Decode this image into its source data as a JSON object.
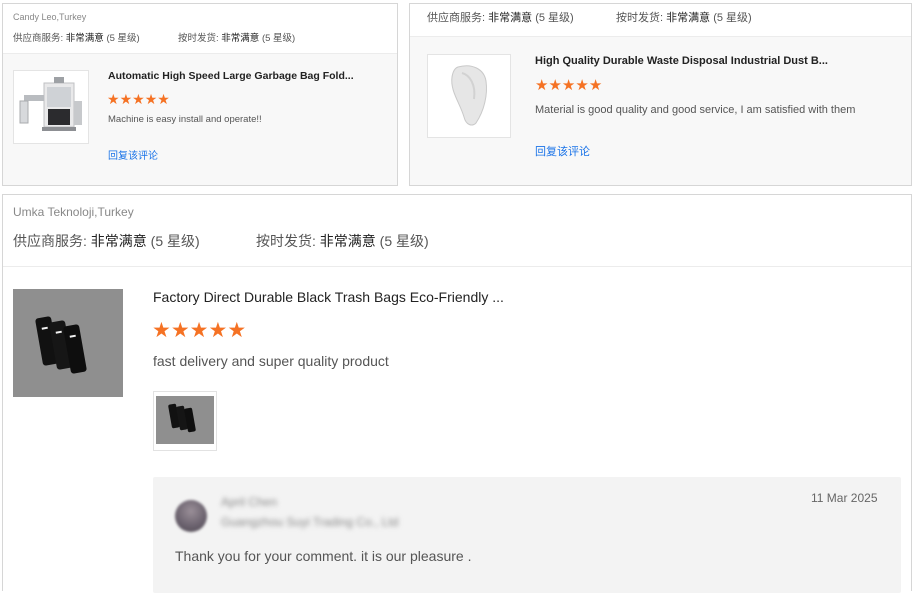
{
  "reviews": [
    {
      "reviewer": "Candy Leo,Turkey",
      "supplier_service_label": "供应商服务:",
      "supplier_service_value": "非常满意",
      "supplier_service_stars": "(5 星级)",
      "on_time_label": "按时发货:",
      "on_time_value": "非常满意",
      "on_time_stars": "(5 星级)",
      "product_title": "Automatic High Speed Large Garbage Bag Fold...",
      "rating": 5,
      "comment": "Machine is easy install and operate!!",
      "reply_link": "回复该评论"
    },
    {
      "reviewer": "",
      "supplier_service_label": "供应商服务:",
      "supplier_service_value": "非常满意",
      "supplier_service_stars": "(5 星级)",
      "on_time_label": "按时发货:",
      "on_time_value": "非常满意",
      "on_time_stars": "(5 星级)",
      "product_title": "High Quality Durable Waste Disposal Industrial Dust B...",
      "rating": 5,
      "comment": "Material is good quality and good service, I am satisfied with them",
      "reply_link": "回复该评论"
    },
    {
      "reviewer": "Umka Teknoloji,Turkey",
      "supplier_service_label": "供应商服务:",
      "supplier_service_value": "非常满意",
      "supplier_service_stars": "(5 星级)",
      "on_time_label": "按时发货:",
      "on_time_value": "非常满意",
      "on_time_stars": "(5 星级)",
      "product_title": "Factory Direct Durable Black Trash Bags Eco-Friendly ...",
      "rating": 5,
      "comment": "fast delivery and super quality product",
      "reply": {
        "author_name": "April Chen",
        "author_company": "Guangzhou Suyi Trading Co., Ltd",
        "date": "11 Mar 2025",
        "text": "Thank you for your comment. it is our pleasure ."
      }
    }
  ],
  "colors": {
    "star": "#f57224",
    "link": "#1a73e8",
    "border": "#d6d6d6"
  },
  "icons": {
    "star": "star-icon"
  }
}
